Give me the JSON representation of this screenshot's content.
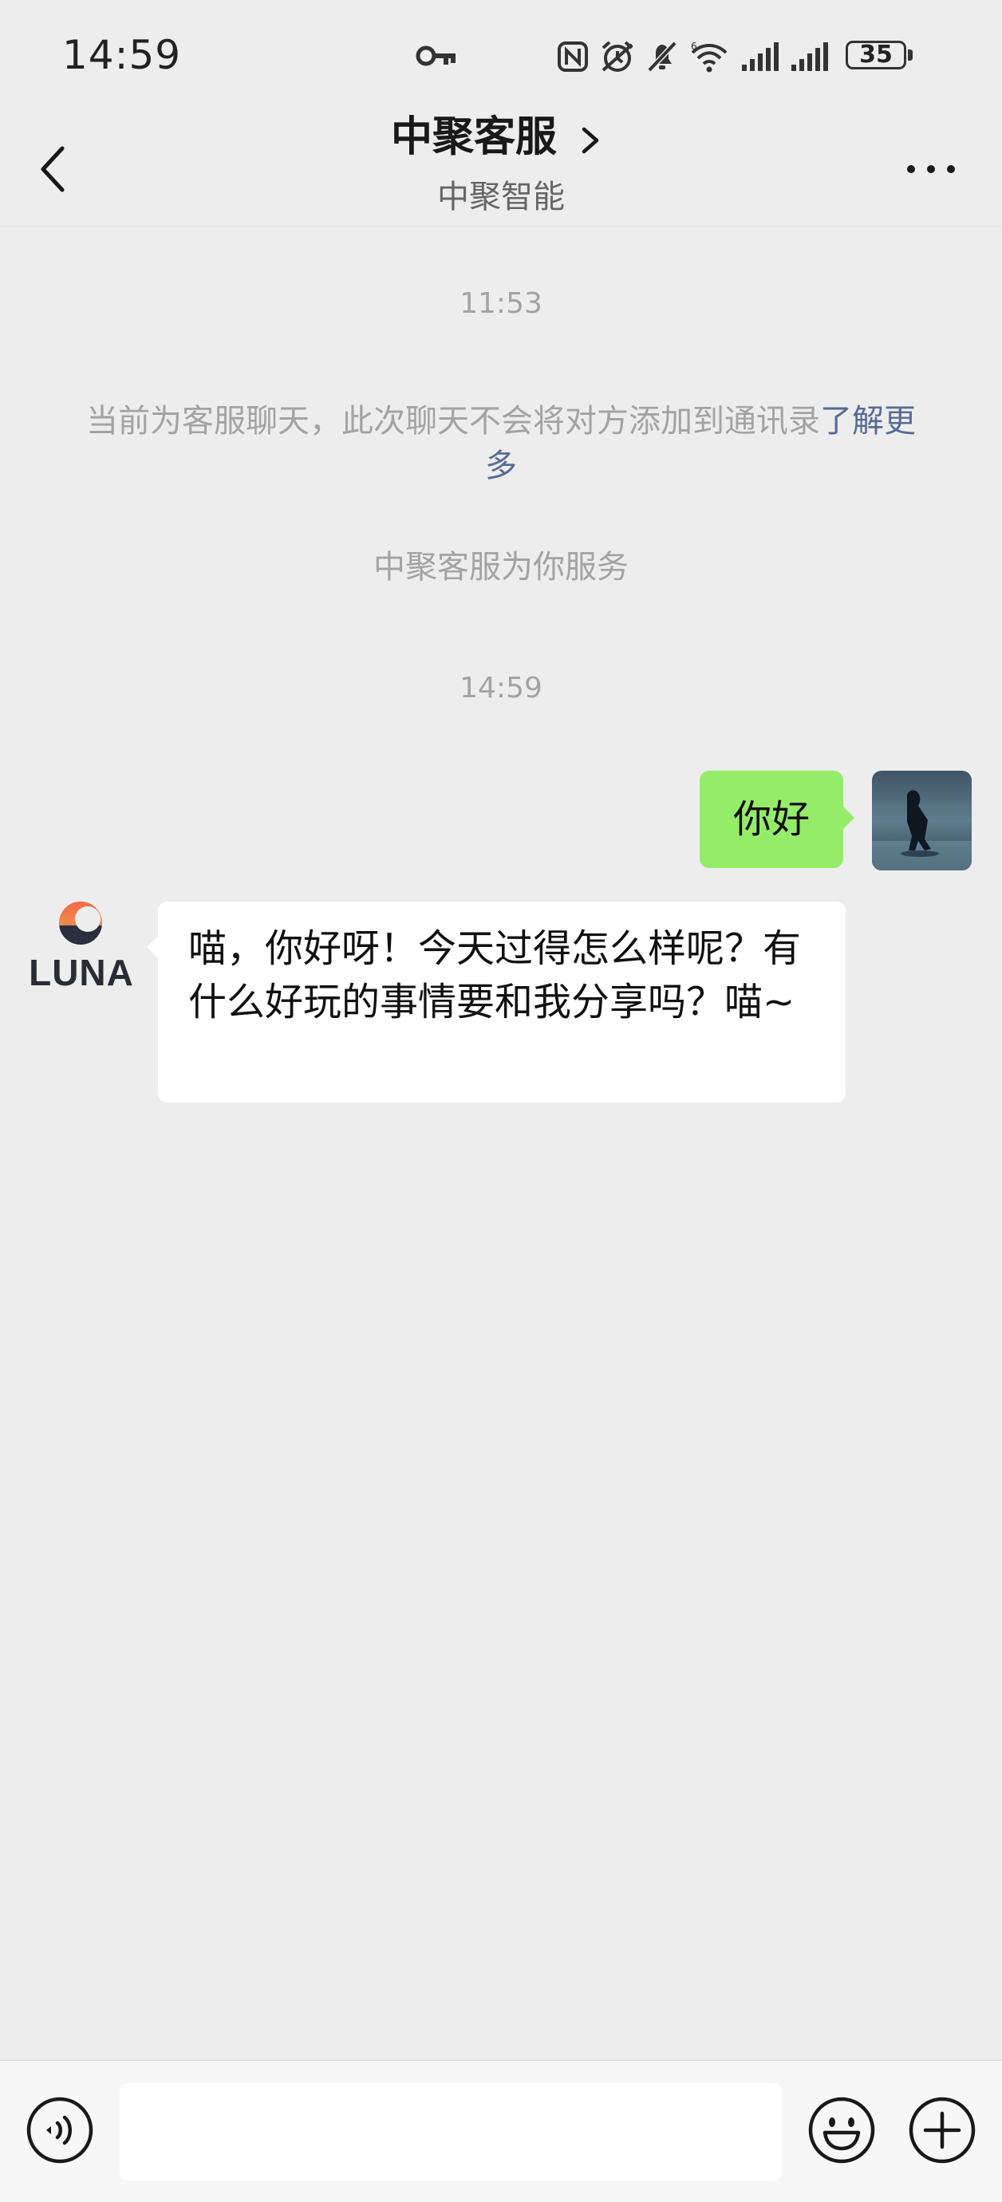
{
  "status_bar": {
    "time": "14:59",
    "battery_level": "35",
    "icons": [
      "key-icon",
      "nfc-icon",
      "alarm-icon",
      "mute-bell-icon",
      "wifi-icon",
      "signal-icon",
      "signal-icon",
      "battery-icon"
    ]
  },
  "header": {
    "title": "中聚客服",
    "subtitle": "中聚智能",
    "icons": [
      "back-arrow-icon",
      "chevron-right-icon",
      "more-dots-icon"
    ]
  },
  "chat": {
    "timestamp_1": "11:53",
    "notice_text": "当前为客服聊天，此次聊天不会将对方添加到通讯录",
    "notice_link": "了解更多",
    "service_text": "中聚客服为你服务",
    "timestamp_2": "14:59",
    "user_message": "你好",
    "bot_name": "LUNA",
    "bot_message": "喵，你好呀！今天过得怎么样呢？有什么好玩的事情要和我分享吗？喵~"
  },
  "input_bar": {
    "input_value": "",
    "icons": [
      "voice-icon",
      "emoji-icon",
      "plus-icon"
    ]
  },
  "colors": {
    "background": "#ededed",
    "user_bubble": "#95ec69",
    "bot_bubble": "#ffffff",
    "link": "#576b95",
    "system_text": "#a3a3a3"
  }
}
